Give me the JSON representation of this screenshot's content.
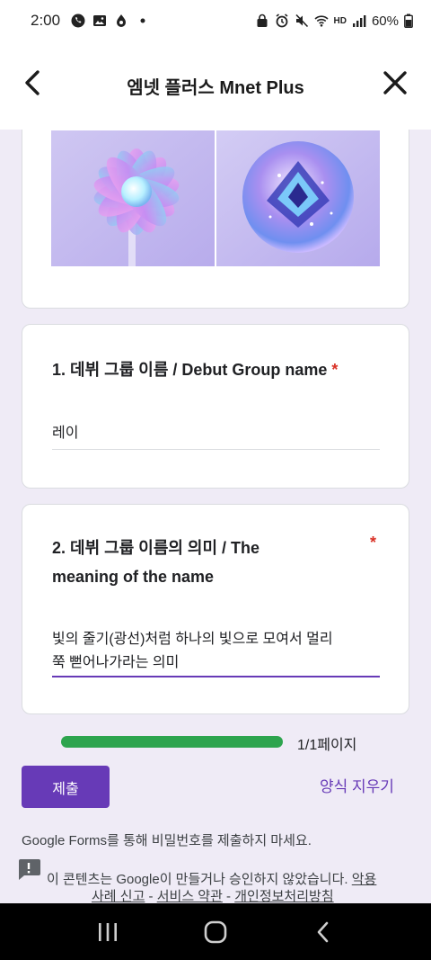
{
  "status_bar": {
    "time": "2:00",
    "battery": "60%",
    "hd_label": "HD"
  },
  "header": {
    "title": "엠넷 플러스 Mnet Plus"
  },
  "form": {
    "questions": [
      {
        "number_title": "1. 데뷔 그룹 이름 / Debut Group name",
        "required_mark": "*",
        "answer": "레이"
      },
      {
        "number_title_line1": "2. 데뷔 그룹 이름의 의미 / The",
        "number_title_line2": "meaning of the name",
        "required_mark": "*",
        "answer_line1": "빛의 줄기(광선)처럼 하나의 빛으로 모여서 멀리",
        "answer_line2": "쭉 뻗어나가라는 의미"
      }
    ],
    "progress": {
      "fraction": 1.0,
      "label": "1/1페이지"
    },
    "submit_label": "제출",
    "clear_label": "양식 지우기",
    "disclaimer": "Google Forms를 통해 비밀번호를 제출하지 마세요.",
    "footer_note": "이 콘텐츠는 Google이 만들거나 승인하지 않았습니다. ",
    "footer_link_report": "악용 사례 신고",
    "footer_link_report_part1": "악용",
    "footer_link_report_part2": "사례 신고",
    "footer_sep1": " - ",
    "footer_link_terms": "서비스 약관",
    "footer_sep2": " - ",
    "footer_link_privacy": "개인정보처리방침"
  },
  "colors": {
    "accent": "#673ab7",
    "required": "#d93025",
    "progress": "#2da44e",
    "background": "#efebf6"
  }
}
